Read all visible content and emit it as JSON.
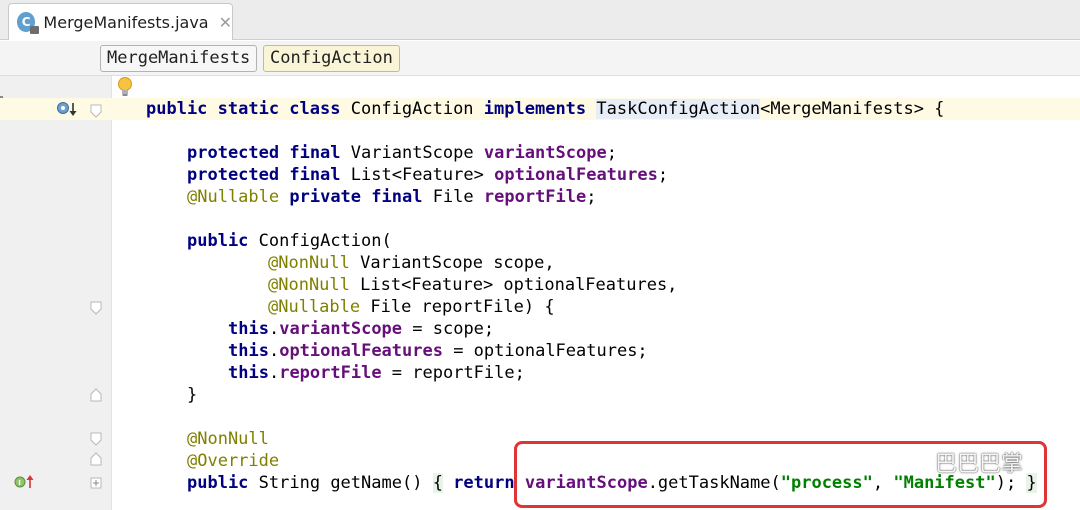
{
  "tab": {
    "icon_letter": "C",
    "label": "MergeManifests.java",
    "close": "✕"
  },
  "breadcrumb": {
    "items": [
      "MergeManifests",
      "ConfigAction"
    ]
  },
  "code": {
    "line1": {
      "kw1": "public static class",
      "name": "ConfigAction",
      "kw2": "implements",
      "iface": "TaskConfigAction",
      "rest": "<MergeManifests> {"
    },
    "line2": {
      "kw": "protected final",
      "type": "VariantScope",
      "field": "variantScope",
      "semi": ";"
    },
    "line3": {
      "kw": "protected final",
      "type": "List<Feature>",
      "field": "optionalFeatures",
      "semi": ";"
    },
    "line4": {
      "ann": "@Nullable",
      "kw": "private final",
      "type": "File",
      "field": "reportFile",
      "semi": ";"
    },
    "line5": {
      "kw": "public",
      "rest": "ConfigAction("
    },
    "line6": {
      "ann": "@NonNull",
      "rest": "VariantScope scope,"
    },
    "line7": {
      "ann": "@NonNull",
      "rest": "List<Feature> optionalFeatures,"
    },
    "line8": {
      "ann": "@Nullable",
      "rest": "File reportFile) {"
    },
    "line9": {
      "kw": "this",
      "dot": ".",
      "field": "variantScope",
      "rest": " = scope;"
    },
    "line10": {
      "kw": "this",
      "dot": ".",
      "field": "optionalFeatures",
      "rest": " = optionalFeatures;"
    },
    "line11": {
      "kw": "this",
      "dot": ".",
      "field": "reportFile",
      "rest": " = reportFile;"
    },
    "line12": {
      "rest": "}"
    },
    "line13": {
      "ann": "@NonNull"
    },
    "line14": {
      "ann": "@Override"
    },
    "line15": {
      "kw": "public",
      "type": "String getName()",
      "brace_open": "{",
      "ret": "return",
      "field": "variantScope",
      "call": ".getTaskName(",
      "str1": "\"process\"",
      "comma": ", ",
      "str2": "\"Manifest\"",
      "close": ");",
      "brace_close": "}"
    }
  },
  "watermark": {
    "text": "巴巴巴掌"
  },
  "colors": {
    "highlight_box": "#e03535",
    "keyword": "#000080",
    "annotation": "#808000",
    "field": "#660e7a",
    "string": "#008000"
  }
}
